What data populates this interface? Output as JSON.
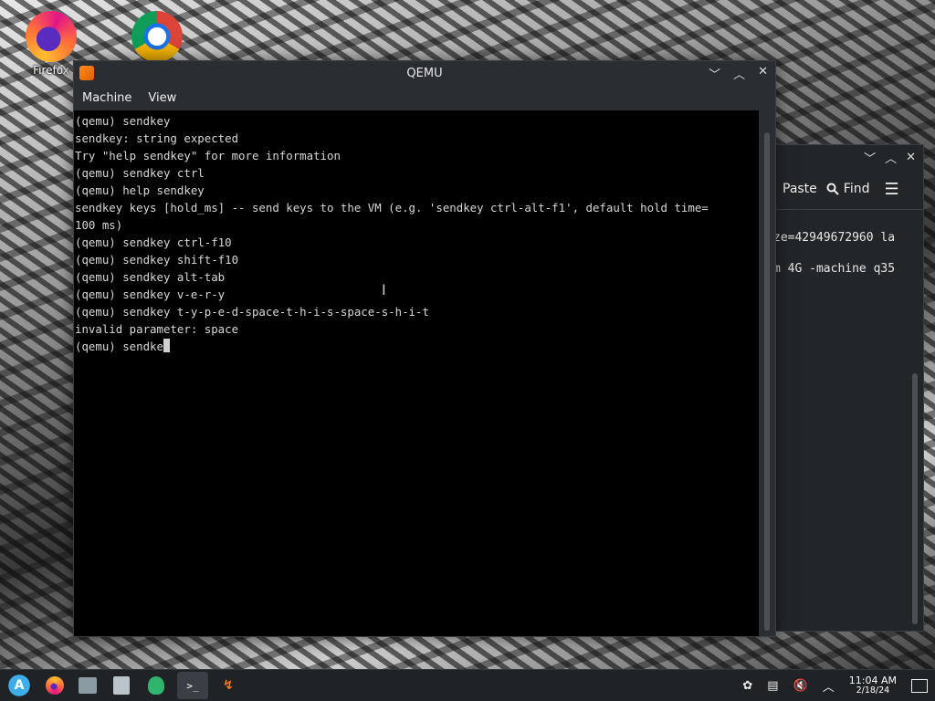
{
  "desktop": {
    "icons": [
      {
        "label": "Firefox",
        "icon": "firefox-icon"
      },
      {
        "label": "",
        "icon": "chrome-icon"
      }
    ]
  },
  "qemu_window": {
    "title": "QEMU",
    "controls": {
      "minimize": "﹀",
      "maximize": "︿",
      "close": "✕"
    },
    "menu": {
      "machine": "Machine",
      "view": "View"
    },
    "console_lines": [
      "(qemu) sendkey",
      "sendkey: string expected",
      "Try \"help sendkey\" for more information",
      "(qemu) sendkey ctrl",
      "(qemu) help sendkey",
      "sendkey keys [hold_ms] -- send keys to the VM (e.g. 'sendkey ctrl-alt-f1', default hold time=",
      "100 ms)",
      "(qemu) sendkey ctrl-f10",
      "(qemu) sendkey shift-f10",
      "(qemu) sendkey alt-tab",
      "(qemu) sendkey v-e-r-y",
      "(qemu) sendkey t-y-p-e-d-space-t-h-i-s-space-s-h-i-t",
      "invalid parameter: space"
    ],
    "prompt_line": "(qemu) sendke"
  },
  "background_window": {
    "paste_label": "Paste",
    "find_label": "Find",
    "lines": [
      "ze=42949672960 la",
      "m 4G -machine q35"
    ]
  },
  "taskbar": {
    "time": "11:04 AM",
    "date": "2/18/24"
  }
}
